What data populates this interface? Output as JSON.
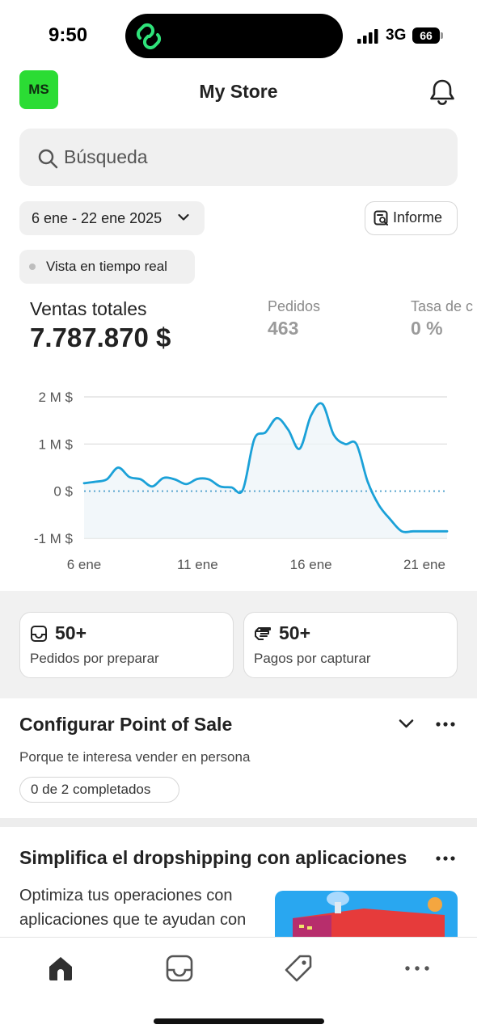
{
  "status_bar": {
    "time": "9:50",
    "network": "3G",
    "battery": "66"
  },
  "header": {
    "avatar_initials": "MS",
    "avatar_color": "#2bdc34",
    "title": "My Store"
  },
  "search": {
    "placeholder": "Búsqueda"
  },
  "filters": {
    "date_range": "6 ene - 22 ene 2025",
    "report_label": "Informe",
    "live_view_label": "Vista en tiempo real"
  },
  "metrics": [
    {
      "label": "Ventas totales",
      "value": "7.787.870 $"
    },
    {
      "label": "Pedidos",
      "value": "463"
    },
    {
      "label": "Tasa de c",
      "value": "0 %"
    }
  ],
  "chart_data": {
    "type": "line",
    "title": "",
    "xlabel": "",
    "ylabel": "",
    "y_tick_labels": [
      "2 M $",
      "1 M $",
      "0 $",
      "-1 M $"
    ],
    "y_ticks": [
      2000000,
      1000000,
      0,
      -1000000
    ],
    "x_tick_labels": [
      "6 ene",
      "11 ene",
      "16 ene",
      "21 ene"
    ],
    "x_ticks": [
      0,
      5,
      10,
      15
    ],
    "ylim": [
      -1000000,
      2000000
    ],
    "xlim": [
      0,
      16
    ],
    "grid": true,
    "line_color": "#1ba1d8",
    "x": [
      0,
      0.5,
      1,
      1.5,
      2,
      2.5,
      3,
      3.5,
      4,
      4.5,
      5,
      5.5,
      6,
      6.5,
      7,
      7.5,
      8,
      8.5,
      9,
      9.5,
      10,
      10.5,
      11,
      11.5,
      12,
      12.5,
      13,
      13.5,
      14,
      14.5,
      15,
      15.5,
      16
    ],
    "values": [
      170000,
      200000,
      250000,
      500000,
      300000,
      250000,
      100000,
      280000,
      250000,
      150000,
      260000,
      250000,
      100000,
      80000,
      30000,
      1100000,
      1250000,
      1550000,
      1300000,
      900000,
      1600000,
      1850000,
      1200000,
      1000000,
      1000000,
      200000,
      -300000,
      -600000,
      -850000,
      -850000,
      -850000,
      -850000,
      -850000
    ],
    "baseline_value": 0
  },
  "action_cards": [
    {
      "icon": "inbox-icon",
      "count": "50+",
      "label": "Pedidos por preparar"
    },
    {
      "icon": "cash-icon",
      "count": "50+",
      "label": "Pagos por capturar"
    }
  ],
  "pos": {
    "title": "Configurar Point of Sale",
    "description": "Porque te interesa vender en persona",
    "progress": "0 de 2 completados"
  },
  "dropshipping": {
    "title": "Simplifica el dropshipping con aplicaciones",
    "description": "Optimiza tus operaciones con aplicaciones que te ayudan con"
  },
  "bottom_nav": [
    {
      "icon": "home-icon",
      "active": true
    },
    {
      "icon": "orders-icon",
      "active": false
    },
    {
      "icon": "tag-icon",
      "active": false
    },
    {
      "icon": "more-icon",
      "active": false
    }
  ]
}
